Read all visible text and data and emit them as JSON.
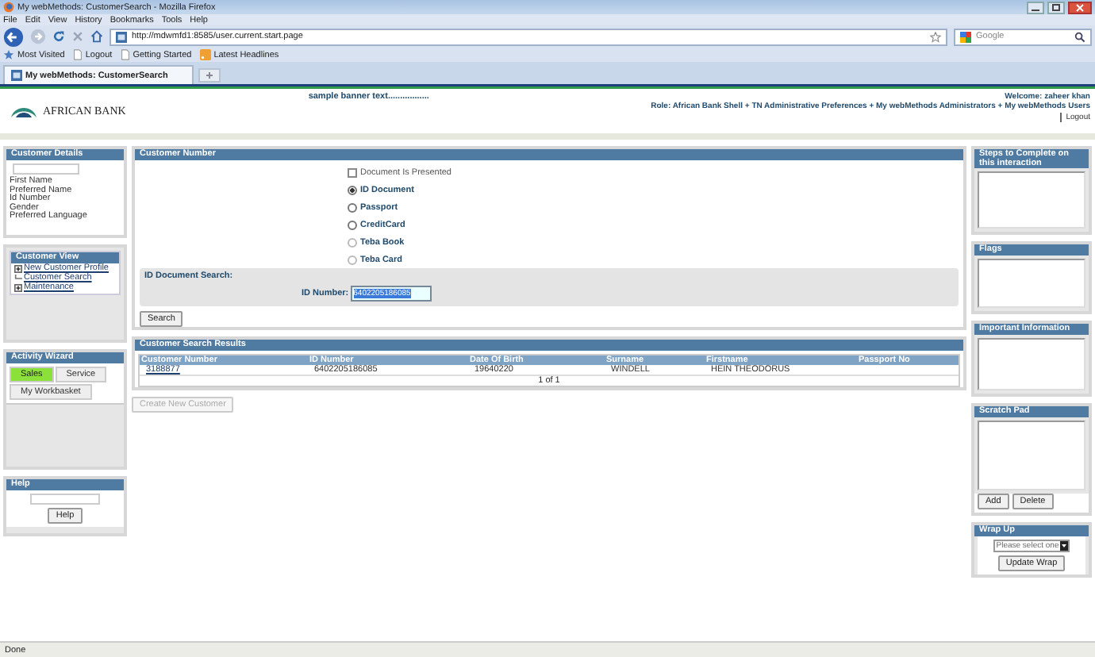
{
  "browser": {
    "title": "My webMethods: CustomerSearch - Mozilla Firefox",
    "menu": [
      "File",
      "Edit",
      "View",
      "History",
      "Bookmarks",
      "Tools",
      "Help"
    ],
    "url": "http://mdwmfd1:8585/user.current.start.page",
    "search_placeholder": "Google",
    "bookmarks": [
      {
        "label": "Most Visited",
        "kind": "star"
      },
      {
        "label": "Logout",
        "kind": "page"
      },
      {
        "label": "Getting Started",
        "kind": "page"
      },
      {
        "label": "Latest Headlines",
        "kind": "feed"
      }
    ],
    "tabs": [
      {
        "label": "My webMethods: CustomerSearch",
        "selected": true
      }
    ]
  },
  "header": {
    "logo_text": "AFRICAN BANK",
    "banner": "sample banner text.................",
    "welcome": "Welcome: zaheer khan",
    "role": "Role: African Bank Shell + TN Administrative Preferences + My webMethods Administrators + My webMethods Users",
    "logout": "Logout"
  },
  "customer_details": {
    "title": "Customer Details",
    "labels": [
      "First Name",
      "Preferred Name",
      "Id Number",
      "Gender",
      "Preferred Language"
    ]
  },
  "customer_view": {
    "title": "Customer View",
    "items": [
      {
        "label": "New Customer Profile",
        "kind": "branch"
      },
      {
        "label": "Customer Search",
        "kind": "leaf"
      },
      {
        "label": "Maintenance",
        "kind": "branch"
      }
    ]
  },
  "activity_wizard": {
    "title": "Activity Wizard",
    "tabs": [
      {
        "label": "Sales",
        "selected": true
      },
      {
        "label": "Service",
        "selected": false
      },
      {
        "label": "My Workbasket",
        "selected": false
      }
    ]
  },
  "help": {
    "title": "Help",
    "button": "Help"
  },
  "customer_number": {
    "title": "Customer Number",
    "document_presented": {
      "label": "Document Is Presented",
      "checked": false
    },
    "options": [
      {
        "label": "ID Document",
        "selected": true,
        "disabled": false
      },
      {
        "label": "Passport",
        "selected": false,
        "disabled": false
      },
      {
        "label": "CreditCard",
        "selected": false,
        "disabled": false
      },
      {
        "label": "Teba Book",
        "selected": false,
        "disabled": true
      },
      {
        "label": "Teba Card",
        "selected": false,
        "disabled": true
      }
    ],
    "search_title": "ID Document Search:",
    "id_label": "ID Number:",
    "id_value": "6402205186085",
    "search_button": "Search"
  },
  "results": {
    "title": "Customer Search Results",
    "columns": [
      "Customer Number",
      "ID Number",
      "Date Of Birth",
      "Surname",
      "Firstname",
      "Passport No"
    ],
    "rows": [
      [
        "3188877",
        "6402205186085",
        "19640220",
        "WINDELL",
        "HEIN THEODORUS",
        ""
      ]
    ],
    "pager": "1 of 1"
  },
  "create_button": {
    "label": "Create New Customer",
    "disabled": true
  },
  "steps": {
    "title": "Steps to Complete on this interaction"
  },
  "flags": {
    "title": "Flags"
  },
  "important": {
    "title": "Important Information"
  },
  "scratch_pad": {
    "title": "Scratch Pad",
    "buttons": [
      "Add",
      "Delete"
    ]
  },
  "wrap_up": {
    "title": "Wrap Up",
    "select_value": "Please select one",
    "button": "Update Wrap"
  },
  "status_bar": "Done"
}
